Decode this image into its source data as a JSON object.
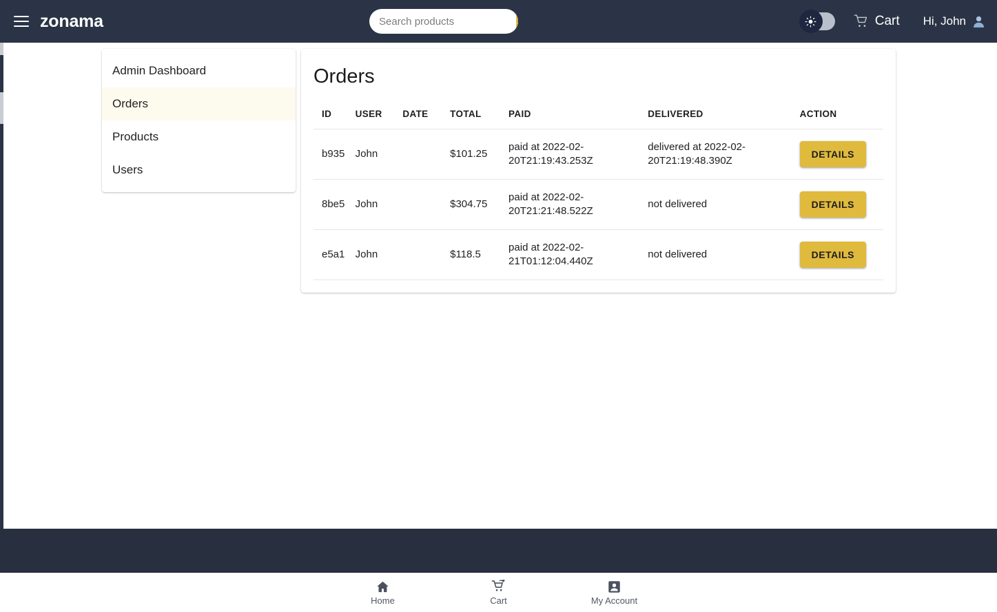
{
  "header": {
    "menu_icon": "hamburger-icon",
    "brand": "zonama",
    "search": {
      "placeholder": "Search products",
      "value": "",
      "icon": "search-icon"
    },
    "dark_mode_toggle": {
      "icon": "sun-icon",
      "state": "off"
    },
    "cart": {
      "label": "Cart",
      "icon": "shopping-cart-icon"
    },
    "account": {
      "label": "Hi, John",
      "icon": "user-avatar-icon"
    }
  },
  "sidebar": {
    "items": [
      {
        "label": "Admin Dashboard",
        "active": false
      },
      {
        "label": "Orders",
        "active": true
      },
      {
        "label": "Products",
        "active": false
      },
      {
        "label": "Users",
        "active": false
      }
    ]
  },
  "main": {
    "title": "Orders",
    "table": {
      "columns": [
        "ID",
        "USER",
        "DATE",
        "TOTAL",
        "PAID",
        "DELIVERED",
        "ACTION"
      ],
      "rows": [
        {
          "id": "b935",
          "user": "John",
          "date": "",
          "total": "$101.25",
          "paid": "paid at 2022-02-20T21:19:43.253Z",
          "delivered": "delivered at 2022-02-20T21:19:48.390Z",
          "action": "DETAILS"
        },
        {
          "id": "8be5",
          "user": "John",
          "date": "",
          "total": "$304.75",
          "paid": "paid at 2022-02-20T21:21:48.522Z",
          "delivered": "not delivered",
          "action": "DETAILS"
        },
        {
          "id": "e5a1",
          "user": "John",
          "date": "",
          "total": "$118.5",
          "paid": "paid at 2022-02-21T01:12:04.440Z",
          "delivered": "not delivered",
          "action": "DETAILS"
        }
      ]
    }
  },
  "bottom_nav": {
    "items": [
      {
        "label": "Home",
        "icon": "home-icon"
      },
      {
        "label": "Cart",
        "icon": "add-shopping-cart-icon"
      },
      {
        "label": "My Account",
        "icon": "account-box-icon"
      }
    ]
  },
  "colors": {
    "header_bg": "#2b3446",
    "footer_bg": "#28303f",
    "accent_gold": "#e0ba3d",
    "active_row_bg": "#fdfaee"
  }
}
